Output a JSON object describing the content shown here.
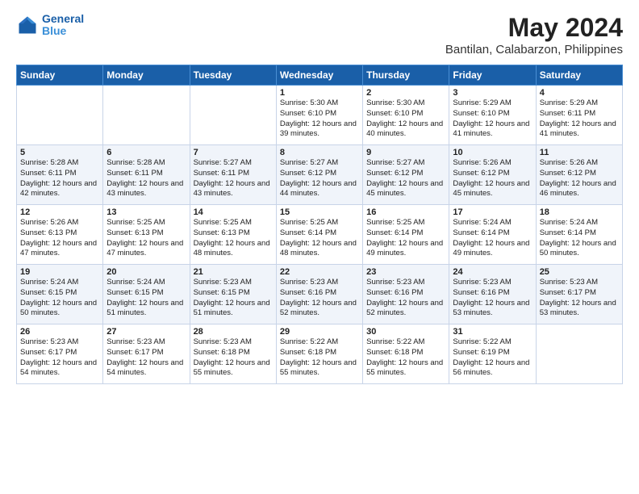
{
  "header": {
    "logo_line1": "General",
    "logo_line2": "Blue",
    "title": "May 2024",
    "subtitle": "Bantilan, Calabarzon, Philippines"
  },
  "columns": [
    "Sunday",
    "Monday",
    "Tuesday",
    "Wednesday",
    "Thursday",
    "Friday",
    "Saturday"
  ],
  "weeks": [
    [
      {
        "day": "",
        "info": ""
      },
      {
        "day": "",
        "info": ""
      },
      {
        "day": "",
        "info": ""
      },
      {
        "day": "1",
        "info": "Sunrise: 5:30 AM\nSunset: 6:10 PM\nDaylight: 12 hours\nand 39 minutes."
      },
      {
        "day": "2",
        "info": "Sunrise: 5:30 AM\nSunset: 6:10 PM\nDaylight: 12 hours\nand 40 minutes."
      },
      {
        "day": "3",
        "info": "Sunrise: 5:29 AM\nSunset: 6:10 PM\nDaylight: 12 hours\nand 41 minutes."
      },
      {
        "day": "4",
        "info": "Sunrise: 5:29 AM\nSunset: 6:11 PM\nDaylight: 12 hours\nand 41 minutes."
      }
    ],
    [
      {
        "day": "5",
        "info": "Sunrise: 5:28 AM\nSunset: 6:11 PM\nDaylight: 12 hours\nand 42 minutes."
      },
      {
        "day": "6",
        "info": "Sunrise: 5:28 AM\nSunset: 6:11 PM\nDaylight: 12 hours\nand 43 minutes."
      },
      {
        "day": "7",
        "info": "Sunrise: 5:27 AM\nSunset: 6:11 PM\nDaylight: 12 hours\nand 43 minutes."
      },
      {
        "day": "8",
        "info": "Sunrise: 5:27 AM\nSunset: 6:12 PM\nDaylight: 12 hours\nand 44 minutes."
      },
      {
        "day": "9",
        "info": "Sunrise: 5:27 AM\nSunset: 6:12 PM\nDaylight: 12 hours\nand 45 minutes."
      },
      {
        "day": "10",
        "info": "Sunrise: 5:26 AM\nSunset: 6:12 PM\nDaylight: 12 hours\nand 45 minutes."
      },
      {
        "day": "11",
        "info": "Sunrise: 5:26 AM\nSunset: 6:12 PM\nDaylight: 12 hours\nand 46 minutes."
      }
    ],
    [
      {
        "day": "12",
        "info": "Sunrise: 5:26 AM\nSunset: 6:13 PM\nDaylight: 12 hours\nand 47 minutes."
      },
      {
        "day": "13",
        "info": "Sunrise: 5:25 AM\nSunset: 6:13 PM\nDaylight: 12 hours\nand 47 minutes."
      },
      {
        "day": "14",
        "info": "Sunrise: 5:25 AM\nSunset: 6:13 PM\nDaylight: 12 hours\nand 48 minutes."
      },
      {
        "day": "15",
        "info": "Sunrise: 5:25 AM\nSunset: 6:14 PM\nDaylight: 12 hours\nand 48 minutes."
      },
      {
        "day": "16",
        "info": "Sunrise: 5:25 AM\nSunset: 6:14 PM\nDaylight: 12 hours\nand 49 minutes."
      },
      {
        "day": "17",
        "info": "Sunrise: 5:24 AM\nSunset: 6:14 PM\nDaylight: 12 hours\nand 49 minutes."
      },
      {
        "day": "18",
        "info": "Sunrise: 5:24 AM\nSunset: 6:14 PM\nDaylight: 12 hours\nand 50 minutes."
      }
    ],
    [
      {
        "day": "19",
        "info": "Sunrise: 5:24 AM\nSunset: 6:15 PM\nDaylight: 12 hours\nand 50 minutes."
      },
      {
        "day": "20",
        "info": "Sunrise: 5:24 AM\nSunset: 6:15 PM\nDaylight: 12 hours\nand 51 minutes."
      },
      {
        "day": "21",
        "info": "Sunrise: 5:23 AM\nSunset: 6:15 PM\nDaylight: 12 hours\nand 51 minutes."
      },
      {
        "day": "22",
        "info": "Sunrise: 5:23 AM\nSunset: 6:16 PM\nDaylight: 12 hours\nand 52 minutes."
      },
      {
        "day": "23",
        "info": "Sunrise: 5:23 AM\nSunset: 6:16 PM\nDaylight: 12 hours\nand 52 minutes."
      },
      {
        "day": "24",
        "info": "Sunrise: 5:23 AM\nSunset: 6:16 PM\nDaylight: 12 hours\nand 53 minutes."
      },
      {
        "day": "25",
        "info": "Sunrise: 5:23 AM\nSunset: 6:17 PM\nDaylight: 12 hours\nand 53 minutes."
      }
    ],
    [
      {
        "day": "26",
        "info": "Sunrise: 5:23 AM\nSunset: 6:17 PM\nDaylight: 12 hours\nand 54 minutes."
      },
      {
        "day": "27",
        "info": "Sunrise: 5:23 AM\nSunset: 6:17 PM\nDaylight: 12 hours\nand 54 minutes."
      },
      {
        "day": "28",
        "info": "Sunrise: 5:23 AM\nSunset: 6:18 PM\nDaylight: 12 hours\nand 55 minutes."
      },
      {
        "day": "29",
        "info": "Sunrise: 5:22 AM\nSunset: 6:18 PM\nDaylight: 12 hours\nand 55 minutes."
      },
      {
        "day": "30",
        "info": "Sunrise: 5:22 AM\nSunset: 6:18 PM\nDaylight: 12 hours\nand 55 minutes."
      },
      {
        "day": "31",
        "info": "Sunrise: 5:22 AM\nSunset: 6:19 PM\nDaylight: 12 hours\nand 56 minutes."
      },
      {
        "day": "",
        "info": ""
      }
    ]
  ]
}
